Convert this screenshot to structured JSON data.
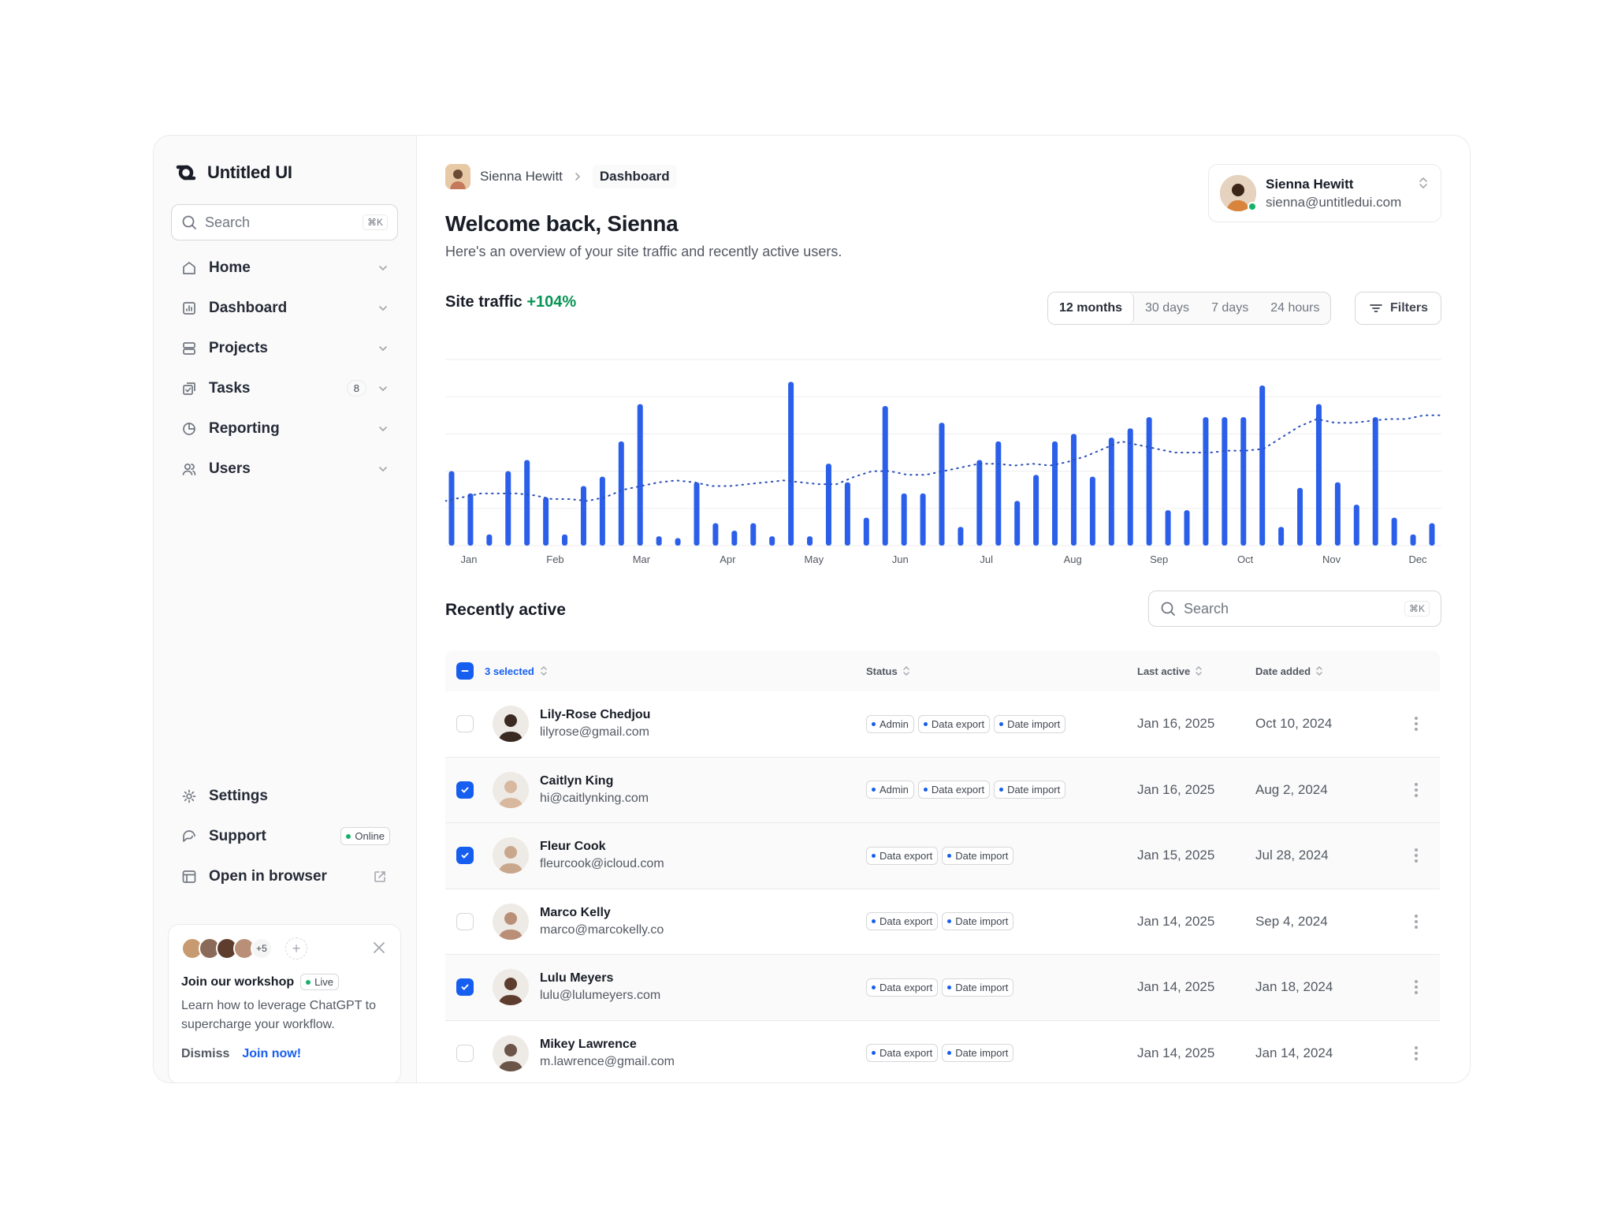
{
  "app": {
    "name": "Untitled UI"
  },
  "sidebar": {
    "search_placeholder": "Search",
    "search_shortcut": "⌘K",
    "items": [
      {
        "label": "Home",
        "icon": "home-icon"
      },
      {
        "label": "Dashboard",
        "icon": "bar-chart-icon"
      },
      {
        "label": "Projects",
        "icon": "layers-icon"
      },
      {
        "label": "Tasks",
        "icon": "check-square-icon",
        "badge": "8"
      },
      {
        "label": "Reporting",
        "icon": "pie-chart-icon"
      },
      {
        "label": "Users",
        "icon": "users-icon"
      }
    ],
    "bottom_items": [
      {
        "label": "Settings",
        "icon": "gear-icon"
      },
      {
        "label": "Support",
        "icon": "headset-icon",
        "status": "Online"
      },
      {
        "label": "Open in browser",
        "icon": "browser-icon"
      }
    ],
    "workshop_card": {
      "more_count": "+5",
      "title": "Join our workshop",
      "badge": "Live",
      "body": "Learn how to leverage ChatGPT to supercharge your workflow.",
      "dismiss": "Dismiss",
      "cta": "Join now!"
    }
  },
  "header": {
    "breadcrumb_user": "Sienna Hewitt",
    "breadcrumb_current": "Dashboard",
    "title": "Welcome back, Sienna",
    "subtitle": "Here's an overview of your site traffic and recently active users.",
    "account_name": "Sienna Hewitt",
    "account_email": "sienna@untitledui.com"
  },
  "traffic": {
    "title": "Site traffic",
    "change": "+104%",
    "ranges": [
      "12 months",
      "30 days",
      "7 days",
      "24 hours"
    ],
    "active_range": "12 months",
    "filters_label": "Filters"
  },
  "chart_data": {
    "type": "bar",
    "x_labels": [
      "Jan",
      "Feb",
      "Mar",
      "Apr",
      "May",
      "Jun",
      "Jul",
      "Aug",
      "Sep",
      "Oct",
      "Nov",
      "Dec"
    ],
    "values": [
      40,
      28,
      6,
      40,
      46,
      26,
      6,
      32,
      37,
      56,
      76,
      5,
      4,
      34,
      12,
      8,
      12,
      5,
      88,
      5,
      44,
      34,
      15,
      75,
      28,
      28,
      66,
      10,
      46,
      56,
      24,
      38,
      56,
      60,
      37,
      58,
      63,
      69,
      19,
      19,
      69,
      69,
      69,
      86,
      10,
      31,
      76,
      34,
      22,
      69,
      15,
      6,
      12
    ],
    "trend": [
      24,
      26,
      28,
      28,
      28,
      27,
      25,
      25,
      24,
      26,
      30,
      32,
      34,
      35,
      34,
      32,
      32,
      33,
      34,
      35,
      34,
      33,
      33,
      37,
      40,
      40,
      38,
      38,
      40,
      42,
      44,
      44,
      43,
      44,
      43,
      45,
      48,
      52,
      56,
      54,
      52,
      50,
      50,
      50,
      51,
      51,
      52,
      58,
      64,
      68,
      66,
      66,
      67,
      68,
      68,
      70,
      70
    ],
    "grid": true,
    "color": "#2b5fea"
  },
  "recent": {
    "title": "Recently active",
    "search_placeholder": "Search",
    "search_shortcut": "⌘K",
    "columns": {
      "selected": "3 selected",
      "status": "Status",
      "last_active": "Last active",
      "date_added": "Date added"
    },
    "rows": [
      {
        "name": "Lily-Rose Chedjou",
        "email": "lilyrose@gmail.com",
        "tags": [
          "Admin",
          "Data export",
          "Date import"
        ],
        "last_active": "Jan 16, 2025",
        "date_added": "Oct 10, 2024",
        "checked": false,
        "avatar_color": "#3a2a22"
      },
      {
        "name": "Caitlyn King",
        "email": "hi@caitlynking.com",
        "tags": [
          "Admin",
          "Data export",
          "Date import"
        ],
        "last_active": "Jan 16, 2025",
        "date_added": "Aug 2, 2024",
        "checked": true,
        "avatar_color": "#d9b8a0"
      },
      {
        "name": "Fleur Cook",
        "email": "fleurcook@icloud.com",
        "tags": [
          "Data export",
          "Date import"
        ],
        "last_active": "Jan 15, 2025",
        "date_added": "Jul 28, 2024",
        "checked": true,
        "avatar_color": "#c9a78d"
      },
      {
        "name": "Marco Kelly",
        "email": "marco@marcokelly.co",
        "tags": [
          "Data export",
          "Date import"
        ],
        "last_active": "Jan 14, 2025",
        "date_added": "Sep 4, 2024",
        "checked": false,
        "avatar_color": "#b98f78"
      },
      {
        "name": "Lulu Meyers",
        "email": "lulu@lulumeyers.com",
        "tags": [
          "Data export",
          "Date import"
        ],
        "last_active": "Jan 14, 2025",
        "date_added": "Jan 18, 2024",
        "checked": true,
        "avatar_color": "#5e3d2e"
      },
      {
        "name": "Mikey Lawrence",
        "email": "m.lawrence@gmail.com",
        "tags": [
          "Data export",
          "Date import"
        ],
        "last_active": "Jan 14, 2025",
        "date_added": "Jan 14, 2024",
        "checked": false,
        "avatar_color": "#6b5548"
      }
    ]
  }
}
